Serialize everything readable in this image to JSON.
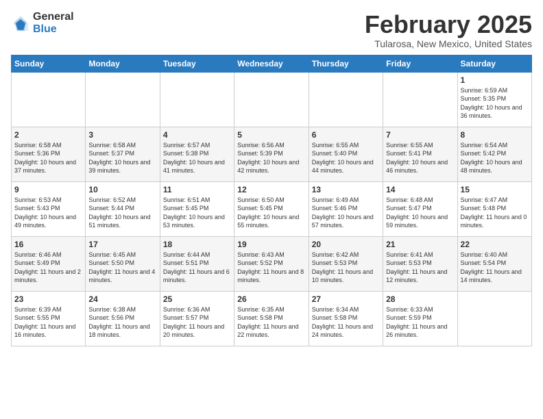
{
  "logo": {
    "general": "General",
    "blue": "Blue"
  },
  "title": "February 2025",
  "location": "Tularosa, New Mexico, United States",
  "days_of_week": [
    "Sunday",
    "Monday",
    "Tuesday",
    "Wednesday",
    "Thursday",
    "Friday",
    "Saturday"
  ],
  "weeks": [
    [
      {
        "day": "",
        "info": ""
      },
      {
        "day": "",
        "info": ""
      },
      {
        "day": "",
        "info": ""
      },
      {
        "day": "",
        "info": ""
      },
      {
        "day": "",
        "info": ""
      },
      {
        "day": "",
        "info": ""
      },
      {
        "day": "1",
        "info": "Sunrise: 6:59 AM\nSunset: 5:35 PM\nDaylight: 10 hours and 36 minutes."
      }
    ],
    [
      {
        "day": "2",
        "info": "Sunrise: 6:58 AM\nSunset: 5:36 PM\nDaylight: 10 hours and 37 minutes."
      },
      {
        "day": "3",
        "info": "Sunrise: 6:58 AM\nSunset: 5:37 PM\nDaylight: 10 hours and 39 minutes."
      },
      {
        "day": "4",
        "info": "Sunrise: 6:57 AM\nSunset: 5:38 PM\nDaylight: 10 hours and 41 minutes."
      },
      {
        "day": "5",
        "info": "Sunrise: 6:56 AM\nSunset: 5:39 PM\nDaylight: 10 hours and 42 minutes."
      },
      {
        "day": "6",
        "info": "Sunrise: 6:55 AM\nSunset: 5:40 PM\nDaylight: 10 hours and 44 minutes."
      },
      {
        "day": "7",
        "info": "Sunrise: 6:55 AM\nSunset: 5:41 PM\nDaylight: 10 hours and 46 minutes."
      },
      {
        "day": "8",
        "info": "Sunrise: 6:54 AM\nSunset: 5:42 PM\nDaylight: 10 hours and 48 minutes."
      }
    ],
    [
      {
        "day": "9",
        "info": "Sunrise: 6:53 AM\nSunset: 5:43 PM\nDaylight: 10 hours and 49 minutes."
      },
      {
        "day": "10",
        "info": "Sunrise: 6:52 AM\nSunset: 5:44 PM\nDaylight: 10 hours and 51 minutes."
      },
      {
        "day": "11",
        "info": "Sunrise: 6:51 AM\nSunset: 5:45 PM\nDaylight: 10 hours and 53 minutes."
      },
      {
        "day": "12",
        "info": "Sunrise: 6:50 AM\nSunset: 5:45 PM\nDaylight: 10 hours and 55 minutes."
      },
      {
        "day": "13",
        "info": "Sunrise: 6:49 AM\nSunset: 5:46 PM\nDaylight: 10 hours and 57 minutes."
      },
      {
        "day": "14",
        "info": "Sunrise: 6:48 AM\nSunset: 5:47 PM\nDaylight: 10 hours and 59 minutes."
      },
      {
        "day": "15",
        "info": "Sunrise: 6:47 AM\nSunset: 5:48 PM\nDaylight: 11 hours and 0 minutes."
      }
    ],
    [
      {
        "day": "16",
        "info": "Sunrise: 6:46 AM\nSunset: 5:49 PM\nDaylight: 11 hours and 2 minutes."
      },
      {
        "day": "17",
        "info": "Sunrise: 6:45 AM\nSunset: 5:50 PM\nDaylight: 11 hours and 4 minutes."
      },
      {
        "day": "18",
        "info": "Sunrise: 6:44 AM\nSunset: 5:51 PM\nDaylight: 11 hours and 6 minutes."
      },
      {
        "day": "19",
        "info": "Sunrise: 6:43 AM\nSunset: 5:52 PM\nDaylight: 11 hours and 8 minutes."
      },
      {
        "day": "20",
        "info": "Sunrise: 6:42 AM\nSunset: 5:53 PM\nDaylight: 11 hours and 10 minutes."
      },
      {
        "day": "21",
        "info": "Sunrise: 6:41 AM\nSunset: 5:53 PM\nDaylight: 11 hours and 12 minutes."
      },
      {
        "day": "22",
        "info": "Sunrise: 6:40 AM\nSunset: 5:54 PM\nDaylight: 11 hours and 14 minutes."
      }
    ],
    [
      {
        "day": "23",
        "info": "Sunrise: 6:39 AM\nSunset: 5:55 PM\nDaylight: 11 hours and 16 minutes."
      },
      {
        "day": "24",
        "info": "Sunrise: 6:38 AM\nSunset: 5:56 PM\nDaylight: 11 hours and 18 minutes."
      },
      {
        "day": "25",
        "info": "Sunrise: 6:36 AM\nSunset: 5:57 PM\nDaylight: 11 hours and 20 minutes."
      },
      {
        "day": "26",
        "info": "Sunrise: 6:35 AM\nSunset: 5:58 PM\nDaylight: 11 hours and 22 minutes."
      },
      {
        "day": "27",
        "info": "Sunrise: 6:34 AM\nSunset: 5:58 PM\nDaylight: 11 hours and 24 minutes."
      },
      {
        "day": "28",
        "info": "Sunrise: 6:33 AM\nSunset: 5:59 PM\nDaylight: 11 hours and 26 minutes."
      },
      {
        "day": "",
        "info": ""
      }
    ]
  ]
}
